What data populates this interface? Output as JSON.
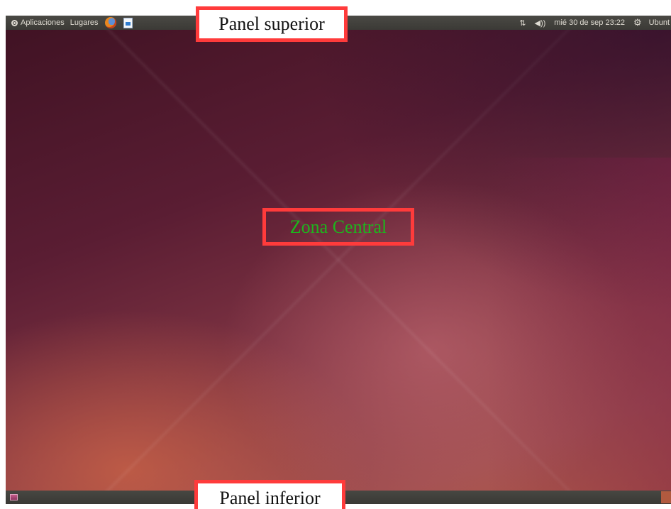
{
  "top_panel": {
    "applications_label": "Aplicaciones",
    "places_label": "Lugares",
    "launchers": [
      "firefox-icon",
      "libreoffice-writer-icon"
    ],
    "network_icon": "⇅",
    "volume_icon": "◀))",
    "clock": "mié 30 de sep 23:22",
    "session_icon": "⚙",
    "user_label": "Ubunt"
  },
  "annotations": {
    "top": "Panel superior",
    "center": "Zona Central",
    "bottom": "Panel inferior"
  },
  "colors": {
    "annotation_border": "#ff3b3b",
    "center_label": "#1db51d",
    "panel": "#3c3b37"
  }
}
